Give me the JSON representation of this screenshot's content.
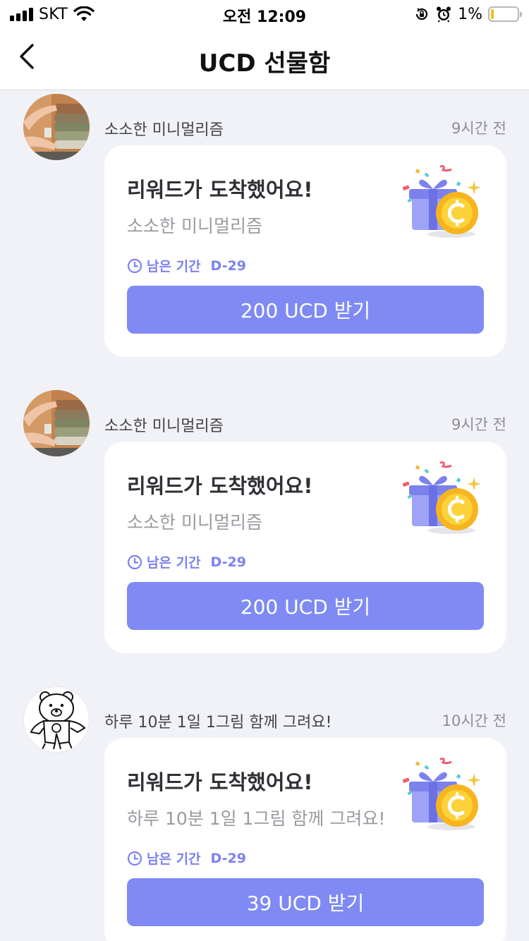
{
  "status_bar": {
    "carrier": "SKT",
    "time": "오전 12:09",
    "battery_percent": "1%",
    "battery_level": 0.01,
    "icons": [
      "signal-icon",
      "wifi-icon",
      "rotation-lock-icon",
      "alarm-icon",
      "battery-icon"
    ]
  },
  "nav": {
    "title": "UCD 선물함",
    "back_icon": "chevron-left-icon"
  },
  "colors": {
    "accent": "#7f8af4",
    "accent_text": "#7b82f0",
    "background": "#f1f2f7",
    "card": "#ffffff"
  },
  "gifts": [
    {
      "sender": "소소한 미니멀리즘",
      "time_ago": "9시간 전",
      "avatar": "clothes-photo",
      "title": "리워드가 도착했어요!",
      "subtitle": "소소한 미니멀리즘",
      "remaining_label": "남은 기간",
      "remaining_value": "D-29",
      "button_label": "200 UCD 받기"
    },
    {
      "sender": "소소한 미니멀리즘",
      "time_ago": "9시간 전",
      "avatar": "clothes-photo",
      "title": "리워드가 도착했어요!",
      "subtitle": "소소한 미니멀리즘",
      "remaining_label": "남은 기간",
      "remaining_value": "D-29",
      "button_label": "200 UCD 받기"
    },
    {
      "sender": "하루 10분 1일 1그림 함께 그려요!",
      "time_ago": "10시간 전",
      "avatar": "bear-drawing",
      "title": "리워드가 도착했어요!",
      "subtitle": "하루 10분 1일 1그림 함께 그려요!",
      "remaining_label": "남은 기간",
      "remaining_value": "D-29",
      "button_label": "39 UCD 받기"
    }
  ]
}
